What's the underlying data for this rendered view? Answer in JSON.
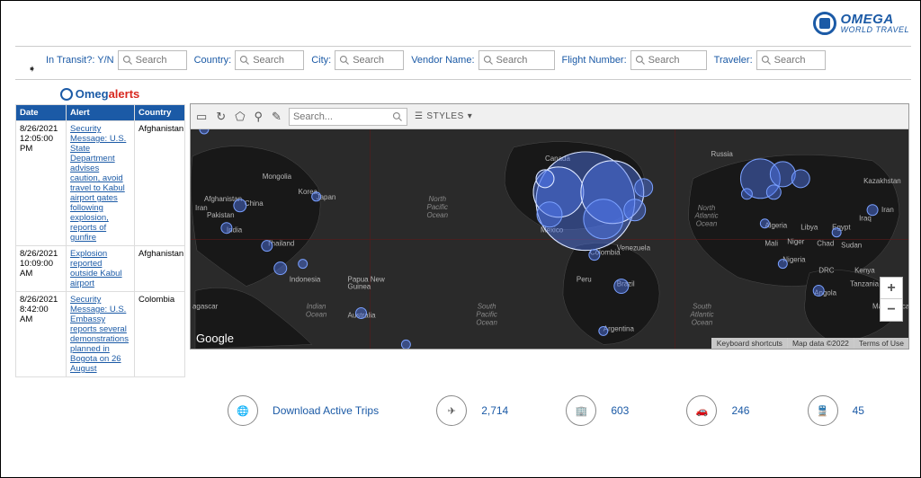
{
  "brand": {
    "name": "OMEGA",
    "sub": "WORLD TRAVEL"
  },
  "filters": {
    "in_transit": {
      "label": "In Transit?: Y/N",
      "placeholder": "Search"
    },
    "country": {
      "label": "Country:",
      "placeholder": "Search"
    },
    "city": {
      "label": "City:",
      "placeholder": "Search"
    },
    "vendor": {
      "label": "Vendor Name:",
      "placeholder": "Search"
    },
    "flight": {
      "label": "Flight Number:",
      "placeholder": "Search"
    },
    "traveler": {
      "label": "Traveler:",
      "placeholder": "Search"
    }
  },
  "omegalerts": {
    "prefix": "Omeg",
    "suffix": "alerts"
  },
  "table": {
    "headers": {
      "date": "Date",
      "alert": "Alert",
      "country": "Country"
    },
    "rows": [
      {
        "date": "8/26/2021 12:05:00 PM",
        "alert": "Security Message: U.S. State Department advises caution, avoid travel to Kabul airport gates following explosion, reports of gunfire",
        "country": "Afghanistan"
      },
      {
        "date": "8/26/2021 10:09:00 AM",
        "alert": "Explosion reported outside Kabul airport",
        "country": "Afghanistan"
      },
      {
        "date": "8/26/2021 8:42:00 AM",
        "alert": "Security Message: U.S. Embassy reports several demonstrations planned in Bogota on 26 August",
        "country": "Colombia"
      }
    ]
  },
  "map_toolbar": {
    "search_placeholder": "Search...",
    "styles_label": "STYLES"
  },
  "map_attribution": {
    "shortcuts": "Keyboard shortcuts",
    "data": "Map data ©2022",
    "terms": "Terms of Use",
    "google": "Google"
  },
  "map_labels": {
    "countries": [
      "Canada",
      "Russia",
      "Kazakhstan",
      "Mongolia",
      "China",
      "Japan",
      "Korea",
      "Iran",
      "Afghanistan",
      "Pakistan",
      "Thailand",
      "Indonesia",
      "Papua New Guinea",
      "Australia",
      "India",
      "agascar",
      "Mali",
      "Niger",
      "Chad",
      "Sudan",
      "Nigeria",
      "DRC",
      "Kenya",
      "Tanzania",
      "Angola",
      "Madagascar",
      "Algeria",
      "Libya",
      "Egypt",
      "Iraq",
      "Brazil",
      "Argentina",
      "Peru",
      "Colombia",
      "Venezuela",
      "Mexico"
    ],
    "oceans": [
      "North Pacific Ocean",
      "South Pacific Ocean",
      "Indian Ocean",
      "North Atlantic Ocean",
      "South Atlantic Ocean"
    ]
  },
  "stats": {
    "download": "Download Active Trips",
    "flights": "2,714",
    "hotels": "603",
    "cars": "246",
    "rail": "45"
  }
}
